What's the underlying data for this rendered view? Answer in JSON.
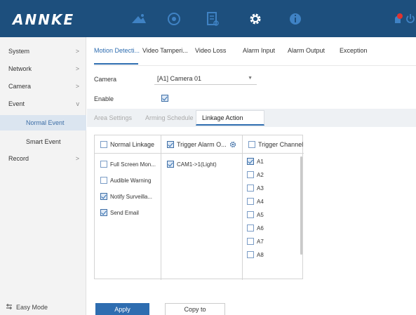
{
  "header": {
    "logo": "ANNKE",
    "nav_icons": [
      "live-view-icon",
      "playback-icon",
      "file-management-icon",
      "configuration-icon",
      "maintenance-icon"
    ],
    "right_icons": [
      "alert-icon",
      "power-icon"
    ],
    "colors": {
      "bar": "#1d4f7d",
      "alert": "#e0332f"
    }
  },
  "sidebar": {
    "items": [
      {
        "label": "System",
        "chevron": ">"
      },
      {
        "label": "Network",
        "chevron": ">"
      },
      {
        "label": "Camera",
        "chevron": ">"
      },
      {
        "label": "Event",
        "chevron": "v"
      },
      {
        "label": "Normal Event"
      },
      {
        "label": "Smart Event"
      },
      {
        "label": "Record",
        "chevron": ">"
      }
    ],
    "easy_mode": "Easy Mode"
  },
  "main": {
    "tabs": [
      "Motion Detecti...",
      "Video Tamperi...",
      "Video Loss",
      "Alarm Input",
      "Alarm Output",
      "Exception"
    ],
    "camera_label": "Camera",
    "camera_value": "[A1] Camera 01",
    "enable_label": "Enable",
    "enable_checked": true,
    "subtabs": [
      "Area Settings",
      "Arming Schedule",
      "Linkage Action"
    ],
    "normal_linkage": {
      "header": "Normal Linkage",
      "items": [
        {
          "label": "Full Screen Mon...",
          "checked": false
        },
        {
          "label": "Audible Warning",
          "checked": false
        },
        {
          "label": "Notify Surveilla...",
          "checked": true
        },
        {
          "label": "Send Email",
          "checked": true
        }
      ]
    },
    "trigger_alarm": {
      "header": "Trigger Alarm O...",
      "items": [
        {
          "label": "CAM1->1(Light)",
          "checked": true
        }
      ]
    },
    "trigger_channel": {
      "header": "Trigger Channel",
      "items": [
        {
          "label": "A1",
          "checked": true
        },
        {
          "label": "A2",
          "checked": false
        },
        {
          "label": "A3",
          "checked": false
        },
        {
          "label": "A4",
          "checked": false
        },
        {
          "label": "A5",
          "checked": false
        },
        {
          "label": "A6",
          "checked": false
        },
        {
          "label": "A7",
          "checked": false
        },
        {
          "label": "A8",
          "checked": false
        }
      ]
    },
    "apply_label": "Apply",
    "copy_label": "Copy to"
  }
}
